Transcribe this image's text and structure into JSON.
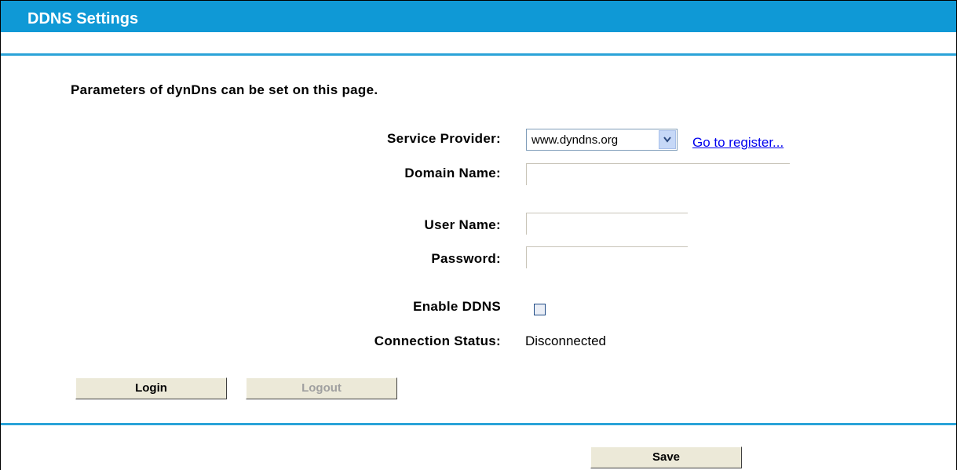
{
  "header": {
    "title": "DDNS Settings"
  },
  "intro": "Parameters of dynDns can be set on this page.",
  "form": {
    "service_provider_label": "Service Provider:",
    "service_provider_value": "www.dyndns.org",
    "register_link": "Go to register...",
    "domain_name_label": "Domain Name:",
    "domain_name_value": "",
    "user_name_label": "User Name:",
    "user_name_value": "",
    "password_label": "Password:",
    "password_value": "",
    "enable_ddns_label": "Enable DDNS",
    "enable_ddns_checked": false,
    "connection_status_label": "Connection Status:",
    "connection_status_value": "Disconnected"
  },
  "buttons": {
    "login": "Login",
    "logout": "Logout",
    "save": "Save"
  },
  "colors": {
    "header_bg": "#0f99d6",
    "rule": "#2aa3d8",
    "link": "#0000ee"
  }
}
